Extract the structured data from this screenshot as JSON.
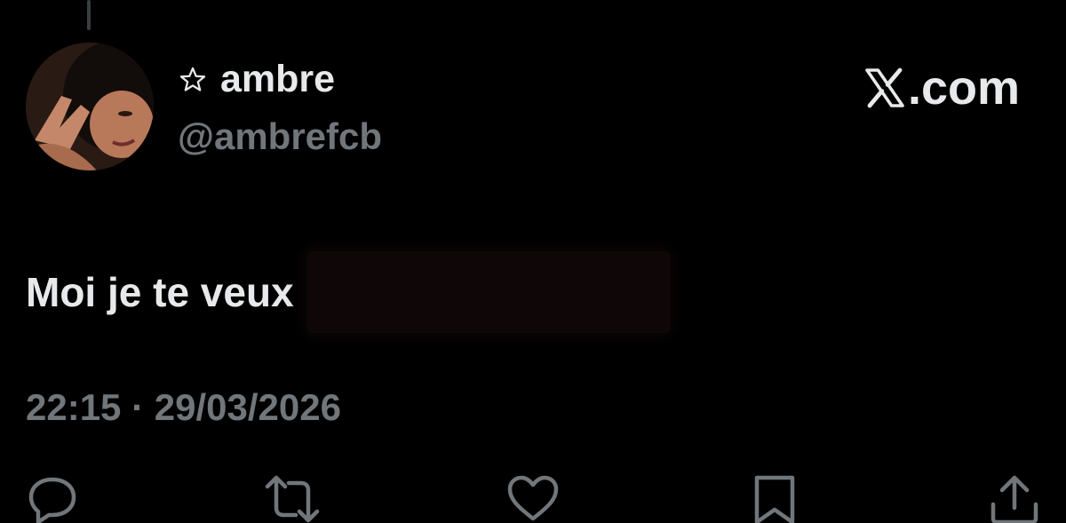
{
  "author": {
    "badge_icon": "star-outline-icon",
    "display_name": "ambre",
    "handle": "@ambrefcb"
  },
  "brand": {
    "logo_icon": "x-logo-icon",
    "domain_text": ".com"
  },
  "tweet": {
    "text": "Moi je te veux",
    "timestamp": "22:15 · 29/03/2026"
  },
  "actions": [
    {
      "icon": "reply-icon"
    },
    {
      "icon": "retweet-icon"
    },
    {
      "icon": "like-icon"
    },
    {
      "icon": "bookmark-icon"
    },
    {
      "icon": "share-icon"
    }
  ],
  "colors": {
    "background": "#000000",
    "primary_text": "#e7e9ea",
    "secondary_text": "#71767b"
  }
}
